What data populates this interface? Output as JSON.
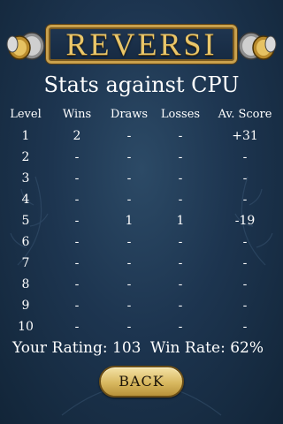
{
  "app": {
    "title": "REVERSI"
  },
  "page": {
    "title": "Stats against CPU"
  },
  "table": {
    "headers": {
      "level": "Level",
      "wins": "Wins",
      "draws": "Draws",
      "losses": "Losses",
      "score": "Av. Score"
    },
    "rows": [
      {
        "level": "1",
        "wins": "2",
        "draws": "-",
        "losses": "-",
        "score": "+31"
      },
      {
        "level": "2",
        "wins": "-",
        "draws": "-",
        "losses": "-",
        "score": "-"
      },
      {
        "level": "3",
        "wins": "-",
        "draws": "-",
        "losses": "-",
        "score": "-"
      },
      {
        "level": "4",
        "wins": "-",
        "draws": "-",
        "losses": "-",
        "score": "-"
      },
      {
        "level": "5",
        "wins": "-",
        "draws": "1",
        "losses": "1",
        "score": "-19"
      },
      {
        "level": "6",
        "wins": "-",
        "draws": "-",
        "losses": "-",
        "score": "-"
      },
      {
        "level": "7",
        "wins": "-",
        "draws": "-",
        "losses": "-",
        "score": "-"
      },
      {
        "level": "8",
        "wins": "-",
        "draws": "-",
        "losses": "-",
        "score": "-"
      },
      {
        "level": "9",
        "wins": "-",
        "draws": "-",
        "losses": "-",
        "score": "-"
      },
      {
        "level": "10",
        "wins": "-",
        "draws": "-",
        "losses": "-",
        "score": "-"
      }
    ]
  },
  "summary": {
    "rating_text": "Your Rating: 103",
    "winrate_text": "Win Rate: 62%"
  },
  "buttons": {
    "back_label": "BACK"
  },
  "icons": {
    "left_decoration": "coin-stack-icon",
    "right_decoration": "coin-stack-icon"
  },
  "colors": {
    "background": "#1d3550",
    "title_gold": "#e9c66a",
    "button_gold": "#d8b85f",
    "text": "#ffffff"
  }
}
